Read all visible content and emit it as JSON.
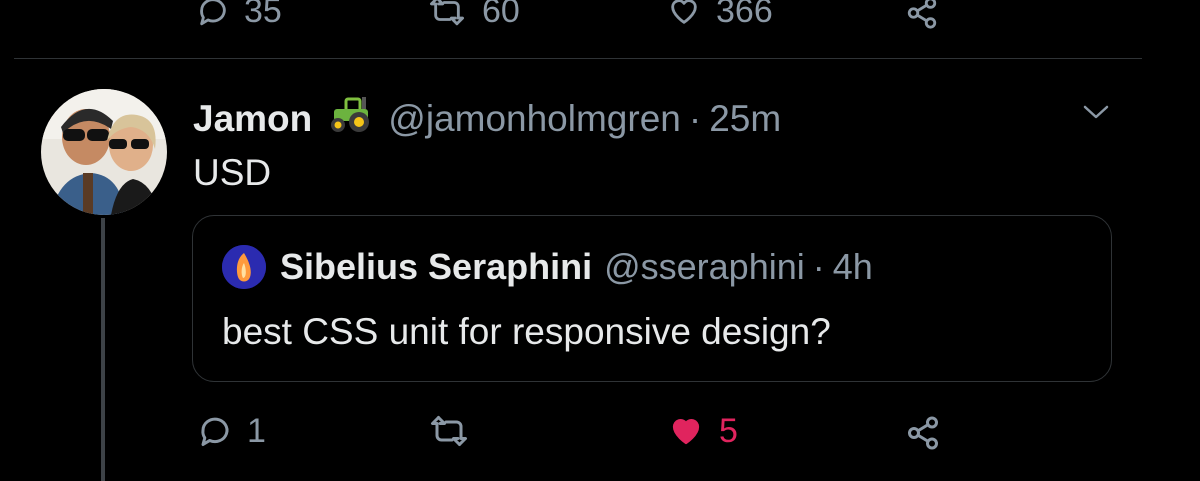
{
  "prev_tweet": {
    "reply_count": "35",
    "retweet_count": "60",
    "like_count": "366"
  },
  "tweet": {
    "author_name": "Jamon",
    "author_emoji": "tractor",
    "handle": "@jamonholmgren",
    "separator": "·",
    "time": "25m",
    "text": "USD",
    "reply_count": "1",
    "retweet_count": "",
    "like_count": "5",
    "liked": true
  },
  "quoted_tweet": {
    "author_name": "Sibelius Seraphini",
    "handle": "@sseraphini",
    "separator": "·",
    "time": "4h",
    "text": "best CSS unit for responsive design?"
  },
  "icons": [
    "reply-icon",
    "retweet-icon",
    "like-icon",
    "share-icon",
    "chevron-down-icon",
    "tractor-icon"
  ],
  "colors": {
    "background": "#000000",
    "secondary_text": "#8b98a5",
    "like_active": "#e0245e",
    "border": "#2f3336"
  }
}
